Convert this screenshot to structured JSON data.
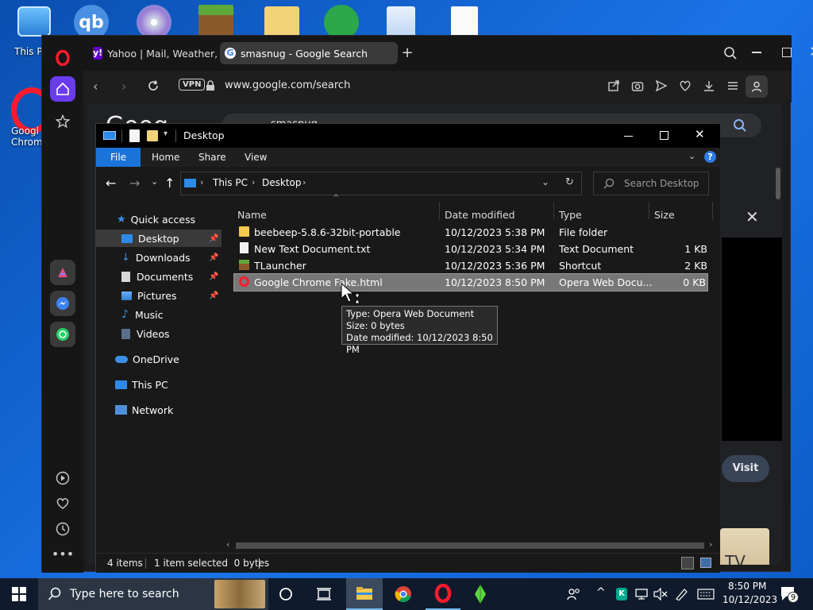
{
  "desktop": {
    "icons": [
      {
        "name": "This PC",
        "label": "This P"
      },
      {
        "name": "Google Chrome",
        "label": "Googl\nChrom"
      }
    ]
  },
  "opera": {
    "tabs": [
      {
        "label": "Yahoo | Mail, Weather, Se",
        "active": false
      },
      {
        "label": "smasnug - Google Search",
        "active": true
      }
    ],
    "address": {
      "vpn_label": "VPN",
      "url": "www.google.com/search"
    },
    "page": {
      "logo_partial": "Goog",
      "query_partial": "smasnug",
      "visit_label": "Visit",
      "tv_partial": "TV"
    }
  },
  "explorer": {
    "title": "Desktop",
    "ribbon_tabs": [
      "File",
      "Home",
      "Share",
      "View"
    ],
    "breadcrumb": [
      "This PC",
      "Desktop"
    ],
    "search_placeholder": "Search Desktop",
    "nav": {
      "quick_access": "Quick access",
      "desktop": "Desktop",
      "downloads": "Downloads",
      "documents": "Documents",
      "pictures": "Pictures",
      "music": "Music",
      "videos": "Videos",
      "onedrive": "OneDrive",
      "this_pc": "This PC",
      "network": "Network"
    },
    "columns": {
      "name": "Name",
      "date": "Date modified",
      "type": "Type",
      "size": "Size"
    },
    "files": [
      {
        "name": "beebeep-5.8.6-32bit-portable",
        "date": "10/12/2023 5:38 PM",
        "type": "File folder",
        "size": "",
        "icon": "folder-icon"
      },
      {
        "name": "New Text Document.txt",
        "date": "10/12/2023 5:34 PM",
        "type": "Text Document",
        "size": "1 KB",
        "icon": "text-document-icon"
      },
      {
        "name": "TLauncher",
        "date": "10/12/2023 5:36 PM",
        "type": "Shortcut",
        "size": "2 KB",
        "icon": "shortcut-icon"
      },
      {
        "name": "Google Chrome Fake.html",
        "date": "10/12/2023 8:50 PM",
        "type": "Opera Web Docu...",
        "size": "0 KB",
        "icon": "opera-document-icon",
        "selected": true
      }
    ],
    "tooltip": {
      "line1": "Type: Opera Web Document",
      "line2": "Size: 0 bytes",
      "line3": "Date modified: 10/12/2023 8:50 PM"
    },
    "status": {
      "items": "4 items",
      "selected": "1 item selected  0 bytes"
    }
  },
  "taskbar": {
    "search_placeholder": "Type here to search",
    "time": "8:50 PM",
    "date": "10/12/2023",
    "notification_count": "9"
  },
  "colors": {
    "accent": "#2d7be5",
    "selection": "#777777",
    "opera_red": "#ff1b2d",
    "opera_sidebar_active": "#6a3cf0"
  }
}
